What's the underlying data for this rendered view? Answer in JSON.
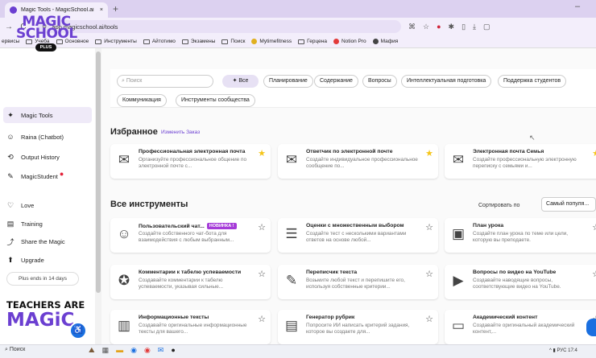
{
  "browser": {
    "tab_title": "Magic Tools - MagicSchool.ai",
    "tab_close": "×",
    "new_tab": "+",
    "url": "app.magicschool.ai/tools",
    "bookmarks_overflow": "ервисы",
    "bookmarks": [
      {
        "label": "Учеба",
        "kind": "folder"
      },
      {
        "label": "Основное",
        "kind": "folder"
      },
      {
        "label": "Инструменты",
        "kind": "folder"
      },
      {
        "label": "Айтотимо",
        "kind": "folder"
      },
      {
        "label": "Экзамены",
        "kind": "folder"
      },
      {
        "label": "Поиск",
        "kind": "folder"
      },
      {
        "label": "Mytimefitness",
        "kind": "site",
        "color": "#e0b020"
      },
      {
        "label": "Герцена",
        "kind": "folder"
      },
      {
        "label": "Notion Pro",
        "kind": "site",
        "color": "#e23a3a"
      },
      {
        "label": "Мафия",
        "kind": "site",
        "color": "#444444"
      }
    ]
  },
  "sidebar": {
    "logo_line1": "MAGIC",
    "logo_line2": "SCHOOL",
    "plus_badge": "PLUS",
    "items": [
      {
        "label": "Magic Tools",
        "icon": "wand-icon",
        "glyph": "✦",
        "active": true
      },
      {
        "label": "Raina (Chatbot)",
        "icon": "robot-icon",
        "glyph": "☺"
      },
      {
        "label": "Output History",
        "icon": "history-icon",
        "glyph": "⟲"
      },
      {
        "label": "MagicStudent",
        "icon": "student-icon",
        "glyph": "✎",
        "dot": true
      },
      {
        "label": "Love",
        "icon": "heart-icon",
        "glyph": "♡"
      },
      {
        "label": "Training",
        "icon": "training-icon",
        "glyph": "▤"
      },
      {
        "label": "Share the Magic",
        "icon": "share-icon",
        "glyph": "⤴"
      },
      {
        "label": "Upgrade",
        "icon": "upgrade-icon",
        "glyph": "⬆"
      }
    ],
    "plus_ends": "Plus ends in 14 days",
    "teachers_are": "TEACHERS ARE",
    "magic_word": "MAGiC"
  },
  "filters": {
    "search_placeholder": "Поиск",
    "all_label": "Все",
    "chips": [
      "Планирование",
      "Содержание",
      "Вопросы",
      "Интеллектуальная подготовка",
      "Поддержка студентов",
      "Коммуникация",
      "Инструменты сообщества"
    ]
  },
  "favorites": {
    "title": "Избранное",
    "change_order": "Изменить Заказ",
    "cards": [
      {
        "title": "Профессиональная электронная почта",
        "desc": "Организуйте профессиональное общение по электронной почте с...",
        "icon": "mailbox-icon",
        "glyph": "✉",
        "starred": true
      },
      {
        "title": "Ответчик по электронной почте",
        "desc": "Создайте индивидуальное профессиональное сообщение по...",
        "icon": "mailbox-icon",
        "glyph": "✉",
        "starred": true
      },
      {
        "title": "Электронная почта Семья",
        "desc": "Создайте профессиональную электронную переписку с семьями и...",
        "icon": "mailbox-icon",
        "glyph": "✉",
        "starred": true
      }
    ]
  },
  "all_tools": {
    "title": "Все инструменты",
    "sort_label": "Сортировать по",
    "sort_value": "Самый популя...",
    "cards": [
      {
        "title": "Пользовательский чат...",
        "new_badge": "НОВИНКА !",
        "desc": "Создайте собственного чат-бота для взаимодействия с любым выбранным...",
        "icon": "robot-icon",
        "glyph": "☺"
      },
      {
        "title": "Оценки с множественным выбором",
        "desc": "Создайте тест с несколькими вариантами ответов на основе любой...",
        "icon": "checklist-icon",
        "glyph": "☰"
      },
      {
        "title": "План урока",
        "desc": "Создайте план урока по теме или цели, которую вы преподаете.",
        "icon": "whiteboard-icon",
        "glyph": "▣"
      },
      {
        "title": "Комментарии к табелю успеваемости",
        "desc": "Создавайте комментарии к табелю успеваемости, указывая сильные...",
        "icon": "medal-icon",
        "glyph": "✪"
      },
      {
        "title": "Переписчик текста",
        "desc": "Возьмите любой текст и перепишите его, используя собственные критерии...",
        "icon": "rewrite-icon",
        "glyph": "✎"
      },
      {
        "title": "Вопросы по видео на YouTube",
        "desc": "Создавайте наводящие вопросы, соответствующие видео на YouTube.",
        "icon": "video-icon",
        "glyph": "▶"
      },
      {
        "title": "Информационные тексты",
        "desc": "Создавайте оригинальные информационные тексты для вашего...",
        "icon": "building-icon",
        "glyph": "▥"
      },
      {
        "title": "Генератор рубрик",
        "desc": "Попросите ИИ написать критерий задания, которое вы создаете для...",
        "icon": "notebook-icon",
        "glyph": "▤"
      },
      {
        "title": "Академический контент",
        "desc": "Создавайте оригинальный академический контент,...",
        "icon": "laptop-icon",
        "glyph": "▭"
      }
    ]
  },
  "taskbar": {
    "search_label": "Поиск",
    "tray_text": "РУС 17:4"
  },
  "colors": {
    "brand": "#6b3fd1",
    "new_badge": "#a53bd8",
    "accent_blue": "#1a6fe0"
  }
}
